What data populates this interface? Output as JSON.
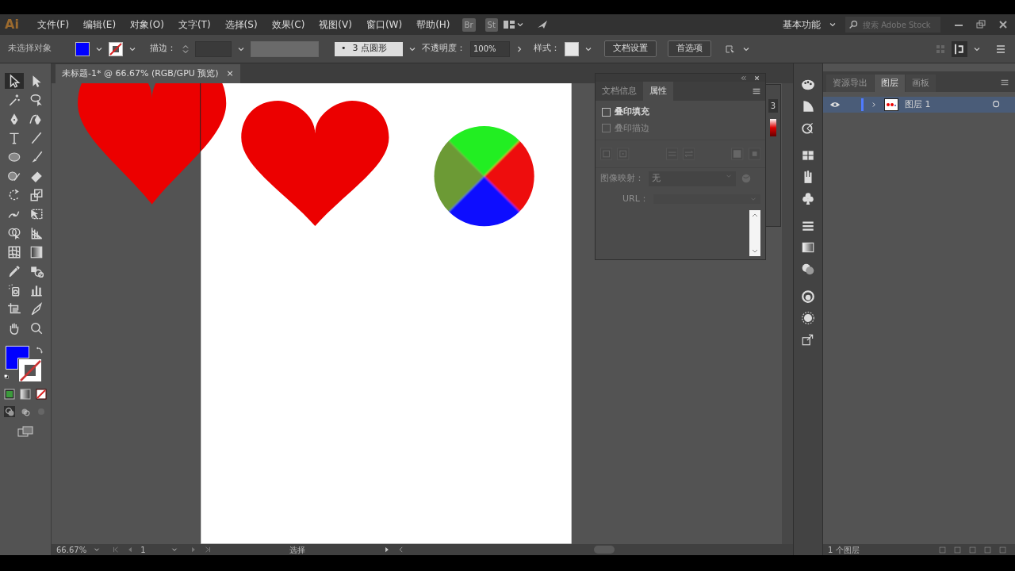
{
  "menu_bar": {
    "app_logo": "Ai",
    "items": [
      "文件(F)",
      "编辑(E)",
      "对象(O)",
      "文字(T)",
      "选择(S)",
      "效果(C)",
      "视图(V)",
      "窗口(W)",
      "帮助(H)"
    ],
    "bridge": "Br",
    "stock": "St",
    "workspace": "基本功能",
    "search": {
      "placeholder": "搜索 Adobe Stock"
    }
  },
  "control_bar": {
    "selection": "未选择对象",
    "stroke_label": "描边：",
    "brush": "3 点圆形",
    "brush_bullet": "•",
    "opacity_label": "不透明度：",
    "opacity": "100%",
    "style_label": "样式：",
    "buttons": [
      "文档设置",
      "首选项"
    ]
  },
  "document_tab": {
    "title": "未标题-1* @ 66.67% (RGB/GPU 预览)",
    "close": "×"
  },
  "attributes_panel": {
    "tabs": [
      {
        "label": "文档信息",
        "selected": false
      },
      {
        "label": "属性",
        "selected": true
      }
    ],
    "checkboxes": [
      {
        "label": "叠印填充",
        "checked": false,
        "disabled": false
      },
      {
        "label": "叠印描边",
        "checked": false,
        "disabled": true
      }
    ],
    "image_map_label": "图像映射：",
    "image_map_value": "无",
    "url_label": "URL："
  },
  "hidden_panel": {
    "text": "3"
  },
  "layers_panel": {
    "tabs": [
      {
        "label": "资源导出",
        "selected": false
      },
      {
        "label": "图层",
        "selected": true
      },
      {
        "label": "画板",
        "selected": false
      }
    ],
    "layers": [
      {
        "name": "图层 1",
        "visible": true,
        "selected": true
      }
    ],
    "footer": "1 个图层"
  },
  "status_bar": {
    "zoom": "66.67%",
    "artboard": "1",
    "tool": "选择"
  }
}
